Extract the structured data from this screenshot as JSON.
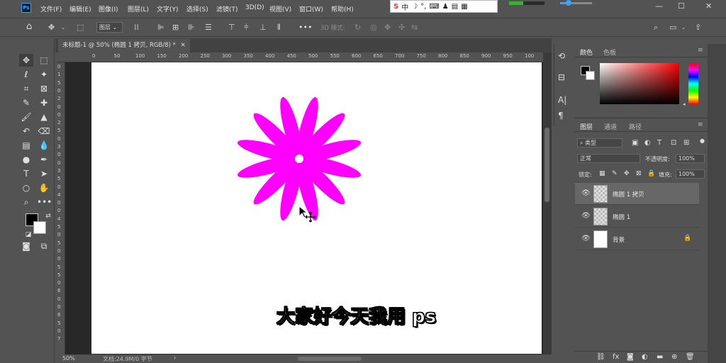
{
  "menubar": {
    "app_icon": "Ps",
    "items": [
      "文件(F)",
      "编辑(E)",
      "图像(I)",
      "图层(L)",
      "文字(Y)",
      "选择(S)",
      "滤镜(T)",
      "3D(D)",
      "视图(V)",
      "窗口(W)",
      "帮助(H)"
    ],
    "ime": {
      "logo": "S",
      "mode": "中"
    },
    "progress": 0.4,
    "window_controls": [
      "—",
      "☐",
      "✕"
    ]
  },
  "options": {
    "layer_select": "图层",
    "mode_3d_label": "3D 模式:"
  },
  "tools": [
    "move-tool",
    "marquee-tool",
    "lasso-tool",
    "magic-wand-tool",
    "crop-tool",
    "frame-tool",
    "eyedropper-tool",
    "healing-brush-tool",
    "brush-tool",
    "stamp-tool",
    "history-brush-tool",
    "eraser-tool",
    "gradient-tool",
    "blur-tool",
    "dodge-tool",
    "pen-tool",
    "type-tool",
    "path-select-tool",
    "shape-tool",
    "hand-tool",
    "zoom-tool",
    "more-tools"
  ],
  "document": {
    "tab_title": "未标题-1 @ 50% (椭圆 1 拷贝, RGB/8) *",
    "zoom": "50%",
    "file_info": "文档:24.9M/0 字节",
    "hruler_ticks": [
      "0",
      "50",
      "100",
      "150",
      "200",
      "250",
      "300",
      "350",
      "400",
      "450",
      "500",
      "550",
      "600",
      "650",
      "700",
      "750",
      "800",
      "850",
      "900",
      "950",
      "100"
    ],
    "vruler_ticks": [
      "0",
      "1",
      "5",
      "0",
      "2",
      "0",
      "0",
      "2",
      "5",
      "0",
      "3",
      "0",
      "0",
      "3",
      "5",
      "0",
      "4",
      "0",
      "0",
      "4",
      "5",
      "0",
      "5",
      "0",
      "0",
      "5",
      "5",
      "0",
      "6",
      "0",
      "0",
      "6",
      "5",
      "0",
      "7"
    ],
    "subtitle": "大家好今天我用 ps",
    "flower_color": "#ff00ff"
  },
  "color_panel": {
    "tabs": [
      "颜色",
      "色板"
    ],
    "foreground": "#000000",
    "background": "#ffffff"
  },
  "layers_panel": {
    "tabs": [
      "图层",
      "通道",
      "路径"
    ],
    "filter_kind": "类型",
    "blend_mode": "正常",
    "opacity_label": "不透明度:",
    "opacity": "100%",
    "lock_label": "锁定:",
    "fill_label": "填充:",
    "fill": "100%",
    "layers": [
      {
        "name": "椭圆 1 拷贝",
        "selected": true
      },
      {
        "name": "椭圆 1",
        "selected": false
      },
      {
        "name": "背景",
        "selected": false
      }
    ]
  }
}
